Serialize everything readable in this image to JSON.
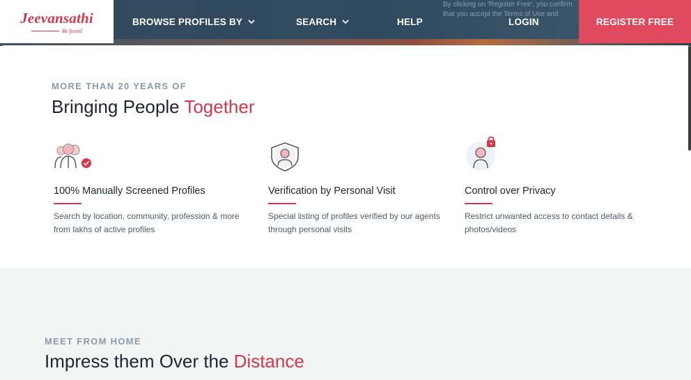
{
  "header": {
    "logo": {
      "name": "Jeevansathi",
      "tagline": "Be found"
    },
    "nav": [
      {
        "label": "BROWSE PROFILES BY",
        "has_dropdown": true
      },
      {
        "label": "SEARCH",
        "has_dropdown": true
      },
      {
        "label": "HELP",
        "has_dropdown": false
      },
      {
        "label": "LOGIN",
        "has_dropdown": false
      }
    ],
    "consent_text": "By clicking on 'Register Free', you confirm that you accept the Terms of Use and Privacy Policy",
    "register_label": "REGISTER FREE"
  },
  "section1": {
    "eyebrow": "MORE THAN 20 YEARS OF",
    "headline_prefix": "Bringing People ",
    "headline_accent": "Together",
    "features": [
      {
        "icon": "people-check-icon",
        "title": "100% Manually Screened Profiles",
        "description": "Search by location, community, profession & more from lakhs of active profiles"
      },
      {
        "icon": "shield-person-icon",
        "title": "Verification by Personal Visit",
        "description": "Special listing of profiles verified by our agents through personal visits"
      },
      {
        "icon": "person-lock-icon",
        "title": "Control over Privacy",
        "description": "Restrict unwanted access to contact details & photos/videos"
      }
    ]
  },
  "section2": {
    "eyebrow": "MEET FROM HOME",
    "headline_prefix": "Impress them Over the ",
    "headline_accent": "Distance"
  },
  "colors": {
    "accent": "#d3394b",
    "register_bg": "#e04a5e",
    "nav_bg": "#34485d",
    "heading": "#1c2633",
    "eyebrow": "#8b9aab"
  }
}
